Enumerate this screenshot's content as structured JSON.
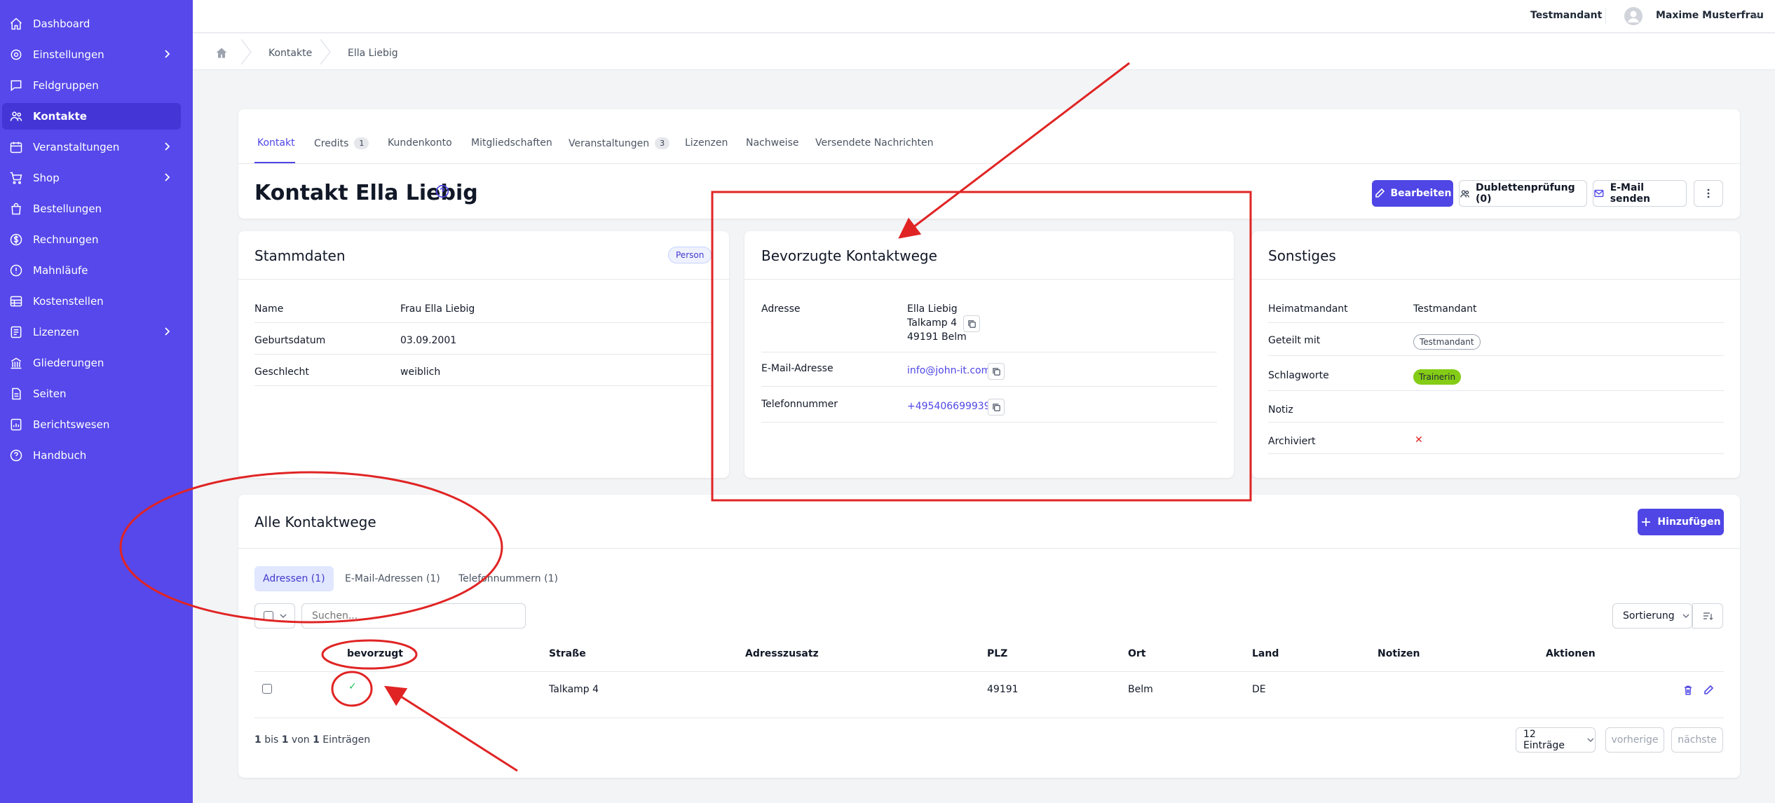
{
  "sidebar": {
    "items": [
      {
        "label": "Dashboard",
        "icon": "home-icon"
      },
      {
        "label": "Einstellungen",
        "icon": "gear-icon"
      },
      {
        "label": "Feldgruppen",
        "icon": "chat-icon"
      },
      {
        "label": "Kontakte",
        "icon": "users-icon"
      },
      {
        "label": "Veranstaltungen",
        "icon": "calendar-icon"
      },
      {
        "label": "Shop",
        "icon": "cart-icon"
      },
      {
        "label": "Bestellungen",
        "icon": "bag-icon"
      },
      {
        "label": "Rechnungen",
        "icon": "dollar-icon"
      },
      {
        "label": "Mahnläufe",
        "icon": "alert-icon"
      },
      {
        "label": "Kostenstellen",
        "icon": "table-icon"
      },
      {
        "label": "Lizenzen",
        "icon": "document-icon"
      },
      {
        "label": "Gliederungen",
        "icon": "building-icon"
      },
      {
        "label": "Seiten",
        "icon": "page-icon"
      },
      {
        "label": "Berichtswesen",
        "icon": "report-icon"
      },
      {
        "label": "Handbuch",
        "icon": "help-icon"
      }
    ]
  },
  "topbar": {
    "tenant": "Testmandant",
    "user": "Maxime Musterfrau"
  },
  "breadcrumb": {
    "items": [
      "Kontakte",
      "Ella Liebig"
    ]
  },
  "tabs": [
    {
      "label": "Kontakt"
    },
    {
      "label": "Credits",
      "badge": "1"
    },
    {
      "label": "Kundenkonto"
    },
    {
      "label": "Mitgliedschaften"
    },
    {
      "label": "Veranstaltungen",
      "badge": "3"
    },
    {
      "label": "Lizenzen"
    },
    {
      "label": "Nachweise"
    },
    {
      "label": "Versendete Nachrichten"
    }
  ],
  "header": {
    "title": "Kontakt Ella Liebig",
    "edit_label": "Bearbeiten",
    "dup_label": "Dublettenprüfung (0)",
    "email_label": "E-Mail senden"
  },
  "stammdaten": {
    "title": "Stammdaten",
    "badge": "Person",
    "rows": [
      {
        "label": "Name",
        "value": "Frau Ella Liebig"
      },
      {
        "label": "Geburtsdatum",
        "value": "03.09.2001"
      },
      {
        "label": "Geschlecht",
        "value": "weiblich"
      }
    ]
  },
  "kontaktwege": {
    "title": "Bevorzugte Kontaktwege",
    "address_label": "Adresse",
    "address_lines": [
      "Ella Liebig",
      "Talkamp 4",
      "49191 Belm"
    ],
    "email_label": "E-Mail-Adresse",
    "email": "info@john-it.com",
    "phone_label": "Telefonnummer",
    "phone": "+4954066999390"
  },
  "sonstiges": {
    "title": "Sonstiges",
    "heimat_label": "Heimatmandant",
    "heimat_value": "Testmandant",
    "geteilt_label": "Geteilt mit",
    "geteilt_badge": "Testmandant",
    "schlag_label": "Schlagworte",
    "schlag_badge": "Trainerin",
    "notiz_label": "Notiz",
    "archiv_label": "Archiviert",
    "archiv_value": "✕"
  },
  "alle": {
    "title": "Alle Kontaktwege",
    "add_label": "Hinzufügen",
    "subtabs": [
      "Adressen (1)",
      "E-Mail-Adressen (1)",
      "Telefonnummern (1)"
    ],
    "search_placeholder": "Suchen...",
    "sort_label": "Sortierung",
    "columns": [
      "bevorzugt",
      "Straße",
      "Adresszusatz",
      "PLZ",
      "Ort",
      "Land",
      "Notizen",
      "Aktionen"
    ],
    "row": {
      "preferred": "✓",
      "street": "Talkamp 4",
      "plz": "49191",
      "ort": "Belm",
      "land": "DE"
    },
    "footer_a": "1",
    "footer_b": " bis ",
    "footer_c": "1",
    "footer_d": " von ",
    "footer_e": "1",
    "footer_f": " Einträgen",
    "per_page": "12 Einträge",
    "prev": "vorherige",
    "next": "nächste"
  },
  "colors": {
    "sidebar": "#5648ea",
    "primary": "#4f46e5",
    "annotation": "#e02424"
  }
}
